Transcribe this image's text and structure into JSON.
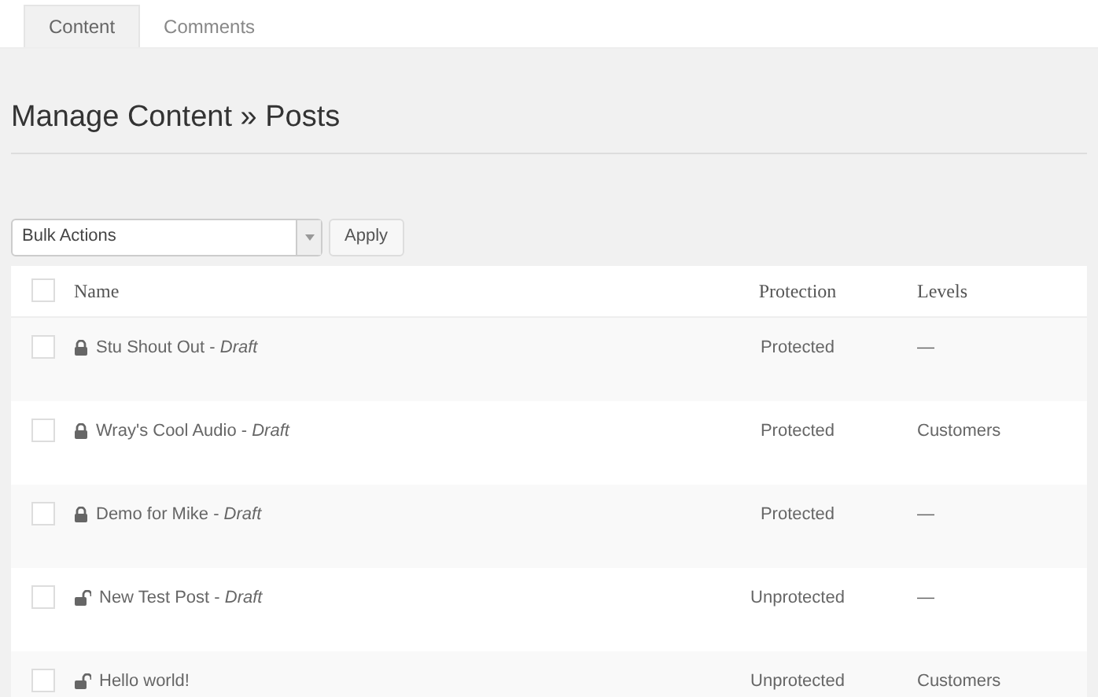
{
  "tabs": [
    {
      "label": "Content",
      "selected": true
    },
    {
      "label": "Comments",
      "selected": false
    }
  ],
  "heading": "Manage Content » Posts",
  "bulk_actions": {
    "value": "Bulk Actions",
    "button": "Apply"
  },
  "table": {
    "select_all_checked": false,
    "columns": [
      "Name",
      "Protection",
      "Levels"
    ],
    "rows": [
      {
        "checked": false,
        "locked": true,
        "name": "Stu Shout Out - *Draft*",
        "protection": "Protected",
        "levels": "—"
      },
      {
        "checked": false,
        "locked": true,
        "name": "Wray's Cool Audio - *Draft*",
        "protection": "Protected",
        "levels": "Customers"
      },
      {
        "checked": false,
        "locked": true,
        "name": "Demo for Mike - *Draft*",
        "protection": "Protected",
        "levels": "—"
      },
      {
        "checked": false,
        "locked": false,
        "name": "New Test Post - *Draft*",
        "protection": "Unprotected",
        "levels": "—"
      },
      {
        "checked": false,
        "locked": false,
        "name": "Hello world!",
        "protection": "Unprotected",
        "levels": "Customers"
      }
    ]
  }
}
